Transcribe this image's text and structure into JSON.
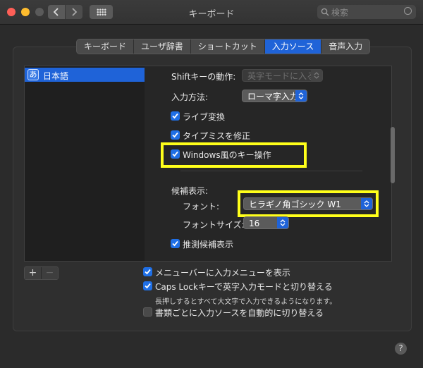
{
  "window": {
    "title": "キーボード"
  },
  "search": {
    "placeholder": "検索"
  },
  "tabs": [
    {
      "label": "キーボード"
    },
    {
      "label": "ユーザ辞書"
    },
    {
      "label": "ショートカット"
    },
    {
      "label": "入力ソース",
      "selected": true
    },
    {
      "label": "音声入力"
    }
  ],
  "input_sources": [
    {
      "label": "日本語",
      "icon_char": "あ",
      "selected": true
    }
  ],
  "settings": {
    "shift_label": "Shiftキーの動作:",
    "shift_value": "英字モードに入る",
    "input_method_label": "入力方法:",
    "input_method_value": "ローマ字入力",
    "live_conversion": "ライブ変換",
    "typo_fix": "タイプミスを修正",
    "windows_keys": "Windows風のキー操作",
    "candidates_label": "候補表示:",
    "font_label": "フォント:",
    "font_value": "ヒラギノ角ゴシック W1",
    "font_size_label": "フォントサイズ:",
    "font_size_value": "16",
    "predictive": "推測候補表示"
  },
  "bottom": {
    "add": "+",
    "remove": "−",
    "show_menu": "メニューバーに入力メニューを表示",
    "caps_lock": "Caps Lockキーで英字入力モードと切り替える",
    "caps_lock_note": "長押しするとすべて大文字で入力できるようになります。",
    "auto_switch": "書類ごとに入力ソースを自動的に切り替える"
  },
  "help": "?",
  "colors": {
    "accent": "#1f63d8",
    "highlight": "#ffff1a"
  }
}
